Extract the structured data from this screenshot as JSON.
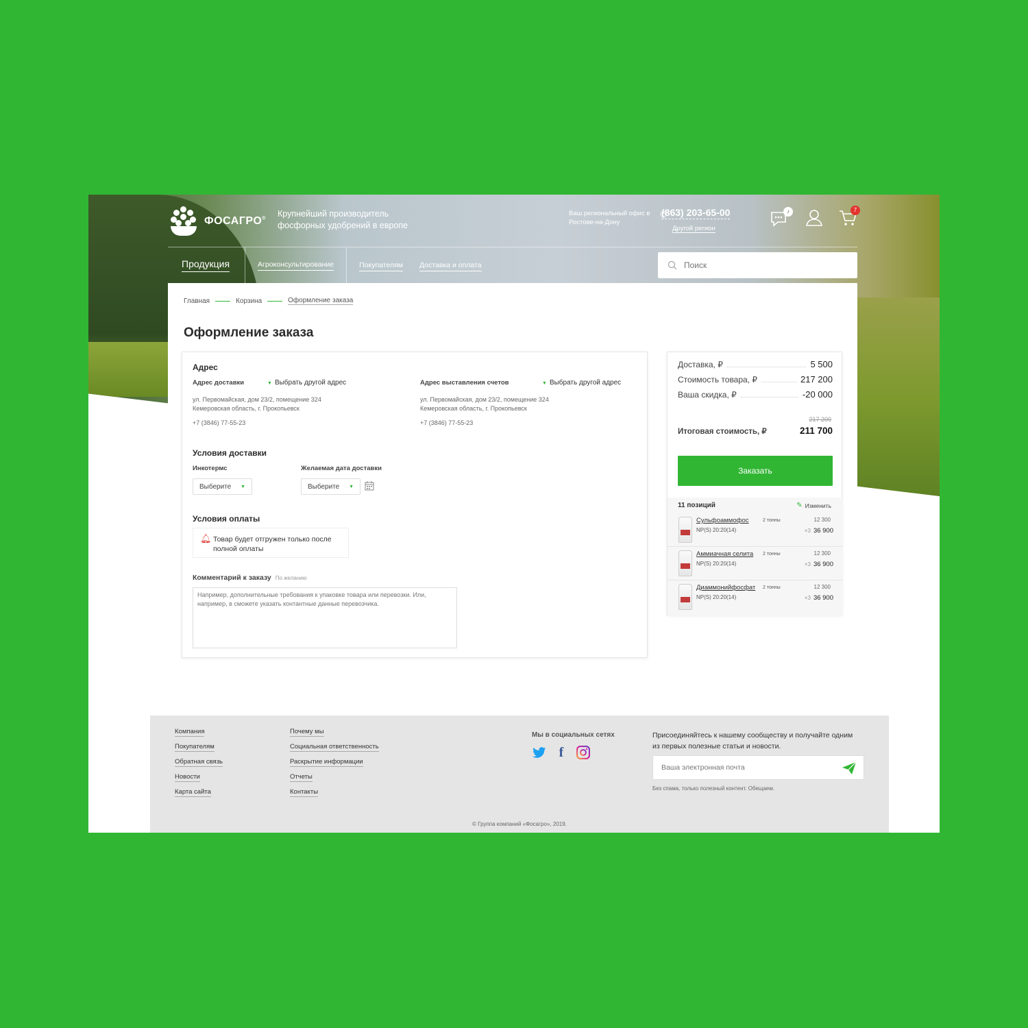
{
  "header": {
    "logo_text": "ФОСАГРО",
    "logo_reg": "®",
    "tagline": "Крупнейший производитель фосфорных удобрений в европе",
    "office_label": "Ваш региональный офис в Ростове-на-Дону",
    "phone": "(863) 203-65-00",
    "region_link": "Другой регион",
    "cart_count": "7"
  },
  "nav": {
    "items": [
      "Продукция",
      "Агроконсультирование",
      "Покупателям",
      "Доставка и оплата"
    ],
    "search_placeholder": "Поиск"
  },
  "breadcrumbs": [
    "Главная",
    "Корзина",
    "Оформление заказа"
  ],
  "page_title": "Оформление заказа",
  "address": {
    "title": "Адрес",
    "delivery_label": "Адрес доставки",
    "billing_label": "Адрес выставления счетов",
    "choose_other": "Выбрать другой адрес",
    "line1": "ул. Первомайская, дом 23/2, помещение 324",
    "line2": "Кемеровская область, г. Прокопьевск",
    "phone": "+7 (3846) 77-55-23"
  },
  "delivery": {
    "title": "Условия доставки",
    "incoterms_label": "Инкотермс",
    "date_label": "Желаемая дата доставки",
    "select_placeholder": "Выберите"
  },
  "payment": {
    "title": "Условия оплаты",
    "notice": "Товар будет отгружен только после полной оплаты"
  },
  "comment": {
    "label": "Комментарий к заказу",
    "optional": "По желанию",
    "placeholder": "Например, дополнительные требования к упаковке товара или перевозки. Или, например, в сможете указать контантные данные перевозчика."
  },
  "summary": {
    "delivery_label": "Доставка,",
    "delivery_value": "5 500",
    "goods_label": "Стоимость товара,",
    "goods_value": "217 200",
    "discount_label": "Ваша скидка,",
    "discount_value": "-20 000",
    "currency": "₽",
    "old_total": "217 200",
    "total_label": "Итоговая стоимость,",
    "total_value": "211 700",
    "order_button": "Заказать",
    "positions": "11 позиций",
    "edit": "Изменить"
  },
  "items": [
    {
      "name": "Сульфоаммофос",
      "code": "NP(S) 20:20(14)",
      "qty": "2 тонны",
      "price": "12 300",
      "mult": "×3",
      "sum": "36 900"
    },
    {
      "name": "Аммиачная селита",
      "code": "NP(S) 20:20(14)",
      "qty": "2 тонны",
      "price": "12 300",
      "mult": "×3",
      "sum": "36 900"
    },
    {
      "name": "Диаммонийфосфат",
      "code": "NP(S) 20:20(14)",
      "qty": "2 тонны",
      "price": "12 300",
      "mult": "×3",
      "sum": "36 900"
    }
  ],
  "footer": {
    "col1": [
      "Компания",
      "Покупателям",
      "Обратная связь",
      "Новости",
      "Карта сайта"
    ],
    "col2": [
      "Почему мы",
      "Социальная ответственность",
      "Раскрытие информации",
      "Отчеты",
      "Контакты"
    ],
    "social_title": "Мы в социальных сетях",
    "social": [
      "twitter-icon",
      "facebook-icon",
      "instagram-icon"
    ],
    "join_text": "Присоединяйтесь к нашему сообществу и получайте одним из первых полезные статьи и новости.",
    "email_placeholder": "Ваша электронная почта",
    "no_spam": "Без спама, только полезный контент. Обещаем.",
    "copyright": "© Группа компаний «Фосагро», 2019."
  },
  "colors": {
    "brand_green": "#31b634",
    "badge_red": "#e3342f"
  }
}
